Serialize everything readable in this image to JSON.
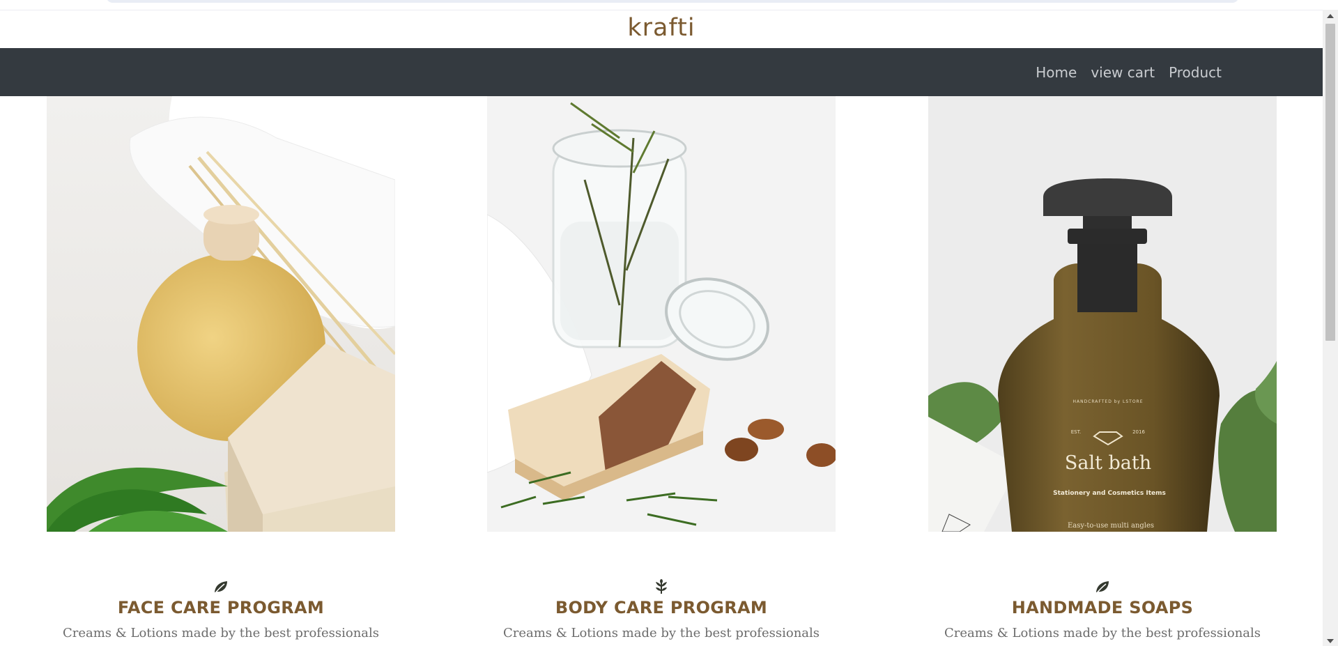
{
  "brand": {
    "logo_text": "krafti",
    "color": "#7b5a30"
  },
  "nav": {
    "background": "#343a40",
    "links": [
      {
        "label": "Home"
      },
      {
        "label": "view cart"
      },
      {
        "label": "Product"
      }
    ]
  },
  "cards": [
    {
      "icon": "leaf-icon",
      "title": "FACE CARE PROGRAM",
      "description": "Creams & Lotions made by the best professionals",
      "image": "diffuser-soap-photo"
    },
    {
      "icon": "herb-sprig-icon",
      "title": "BODY CARE PROGRAM",
      "description": "Creams & Lotions made by the best professionals",
      "image": "soap-rosemary-jar-photo"
    },
    {
      "icon": "leaf-icon",
      "title": "HANDMADE SOAPS",
      "description": "Creams & Lotions made by the best professionals",
      "image": "salt-bath-bottle-photo",
      "label": {
        "top": "HANDCRAFTED by LSTORE",
        "est": "EST.",
        "year": "2016",
        "name": "Salt bath",
        "sub": "Stationery and Cosmetics Items",
        "footer": "Easy-to-use multi angles"
      }
    }
  ]
}
